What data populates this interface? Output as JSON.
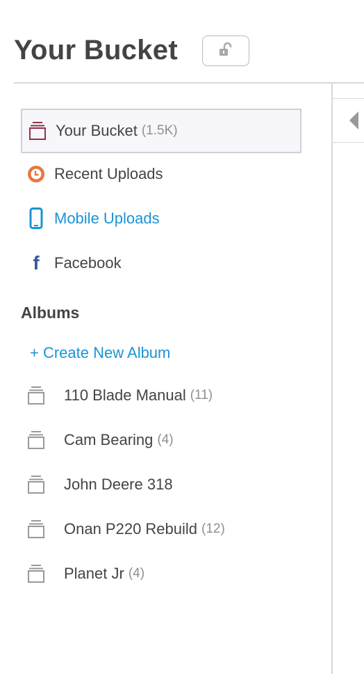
{
  "header": {
    "title": "Your Bucket",
    "lock_icon": "unlocked-padlock-icon"
  },
  "sidebar": {
    "items": [
      {
        "label": "Your Bucket",
        "count": "(1.5K)",
        "icon": "bucket-icon",
        "icon_color": "#8e3449",
        "selected": true
      },
      {
        "label": "Recent Uploads",
        "count": "",
        "icon": "clock-icon",
        "icon_color": "#e8773a",
        "selected": false
      },
      {
        "label": "Mobile Uploads",
        "count": "",
        "icon": "phone-icon",
        "icon_color": "#1a94d6",
        "selected": false
      },
      {
        "label": "Facebook",
        "count": "",
        "icon": "facebook-icon",
        "icon_color": "#3b5998",
        "selected": false
      }
    ],
    "albums_heading": "Albums",
    "create_album_label": "+ Create New Album",
    "albums": [
      {
        "label": "110 Blade Manual",
        "count": "(11)"
      },
      {
        "label": "Cam Bearing",
        "count": "(4)"
      },
      {
        "label": "John Deere 318",
        "count": ""
      },
      {
        "label": "Onan P220 Rebuild",
        "count": "(12)"
      },
      {
        "label": "Planet Jr",
        "count": "(4)"
      }
    ]
  },
  "colors": {
    "accent": "#1a94d6",
    "text": "#444444",
    "muted": "#8f8f8f",
    "divider": "#d8d8d8"
  }
}
